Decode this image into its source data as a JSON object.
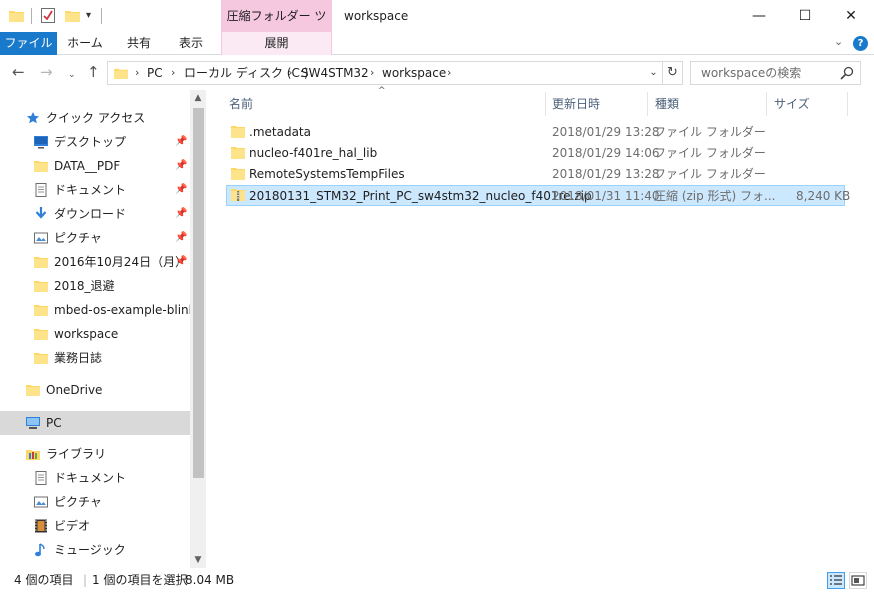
{
  "title_bar": {
    "context_tab": "圧縮フォルダー ツール",
    "window_title": "workspace",
    "minimize": "—",
    "maximize": "☐",
    "close": "✕"
  },
  "ribbon": {
    "tabs": [
      "ファイル",
      "ホーム",
      "共有",
      "表示"
    ],
    "context_sub_tab": "展開",
    "accent_color": "#1979ca",
    "context_color": "#f5c8df"
  },
  "address_bar": {
    "crumbs": [
      "PC",
      "ローカル ディスク (C:)",
      "SW4STM32",
      "workspace"
    ],
    "search_placeholder": "workspaceの検索"
  },
  "nav_pane": {
    "quick_access": "クイック アクセス",
    "pinned": [
      {
        "label": "デスクトップ",
        "icon": "desktop-icon"
      },
      {
        "label": "DATA__PDF",
        "icon": "folder-icon"
      },
      {
        "label": "ドキュメント",
        "icon": "document-icon"
      },
      {
        "label": "ダウンロード",
        "icon": "download-icon"
      },
      {
        "label": "ピクチャ",
        "icon": "picture-icon"
      },
      {
        "label": "2016年10月24日（月）",
        "icon": "folder-icon"
      }
    ],
    "recent": [
      {
        "label": "2018_退避",
        "icon": "folder-icon"
      },
      {
        "label": "mbed-os-example-blinky",
        "icon": "folder-icon"
      },
      {
        "label": "workspace",
        "icon": "folder-icon"
      },
      {
        "label": "業務日誌",
        "icon": "folder-icon"
      }
    ],
    "onedrive": "OneDrive",
    "pc": "PC",
    "library": "ライブラリ",
    "library_items": [
      {
        "label": "ドキュメント",
        "icon": "document-icon"
      },
      {
        "label": "ピクチャ",
        "icon": "picture-icon"
      },
      {
        "label": "ビデオ",
        "icon": "video-icon"
      },
      {
        "label": "ミュージック",
        "icon": "music-icon"
      }
    ]
  },
  "file_list": {
    "columns": [
      "名前",
      "更新日時",
      "種類",
      "サイズ"
    ],
    "rows": [
      {
        "name": ".metadata",
        "date": "2018/01/29 13:28",
        "type": "ファイル フォルダー",
        "size": "",
        "icon": "folder-icon"
      },
      {
        "name": "nucleo-f401re_hal_lib",
        "date": "2018/01/29 14:06",
        "type": "ファイル フォルダー",
        "size": "",
        "icon": "folder-icon"
      },
      {
        "name": "RemoteSystemsTempFiles",
        "date": "2018/01/29 13:28",
        "type": "ファイル フォルダー",
        "size": "",
        "icon": "folder-icon"
      },
      {
        "name": "20180131_STM32_Print_PC_sw4stm32_nucleo_f401re.zip",
        "date": "2018/01/31 11:40",
        "type": "圧縮 (zip 形式) フォ...",
        "size": "8,240 KB",
        "icon": "zip-folder-icon"
      }
    ]
  },
  "status_bar": {
    "item_count": "4 個の項目",
    "selection": "1 個の項目を選択",
    "size": "8.04 MB"
  }
}
